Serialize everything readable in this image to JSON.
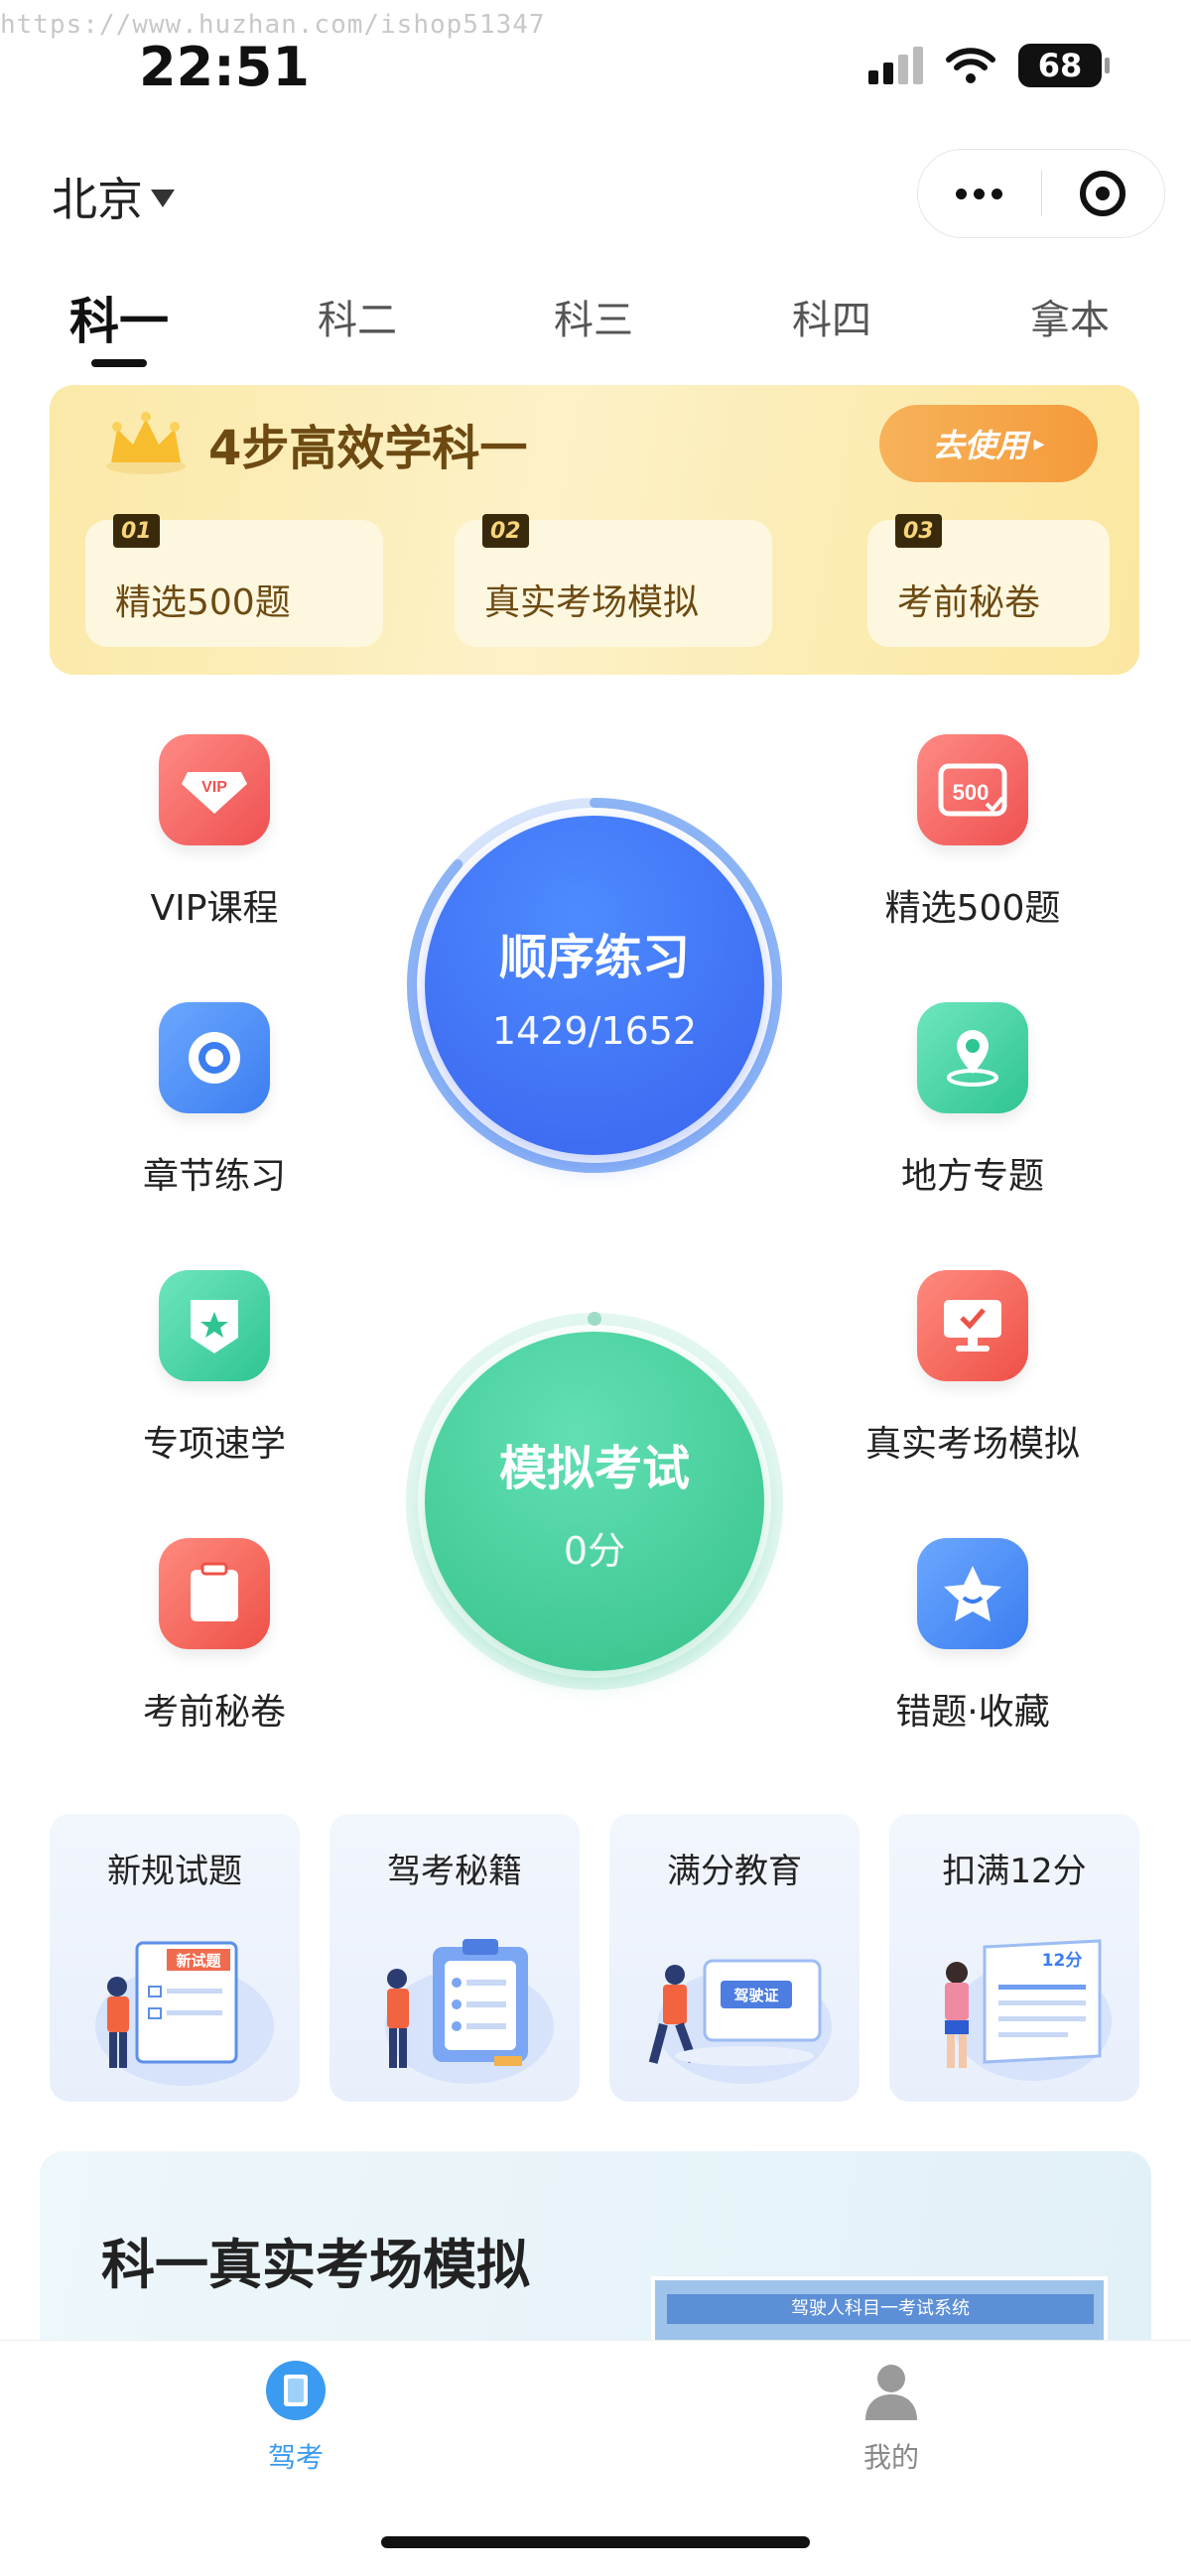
{
  "watermark": "https://www.huzhan.com/ishop51347",
  "status_bar": {
    "time": "22:51",
    "battery": "68"
  },
  "header": {
    "city": "北京"
  },
  "tabs": [
    {
      "label": "科一",
      "active": true
    },
    {
      "label": "科二",
      "active": false
    },
    {
      "label": "科三",
      "active": false
    },
    {
      "label": "科四",
      "active": false
    },
    {
      "label": "拿本",
      "active": false
    }
  ],
  "banner": {
    "title": "4步高效学科一",
    "button_label": "去使用",
    "steps": [
      {
        "num": "01",
        "label": "精选500题"
      },
      {
        "num": "02",
        "label": "真实考场模拟"
      },
      {
        "num": "03",
        "label": "考前秘卷"
      }
    ]
  },
  "features": {
    "left": [
      {
        "label": "VIP课程",
        "icon": "vip-icon",
        "color": "#f26a6a"
      },
      {
        "label": "章节练习",
        "icon": "target-icon",
        "color": "#4a8ff2"
      },
      {
        "label": "专项速学",
        "icon": "shield-star-icon",
        "color": "#3fd0a2"
      },
      {
        "label": "考前秘卷",
        "icon": "clipboard-icon",
        "color": "#f56a63"
      }
    ],
    "right": [
      {
        "label": "精选500题",
        "icon": "500-badge-icon",
        "color": "#f26a6a"
      },
      {
        "label": "地方专题",
        "icon": "location-icon",
        "color": "#3fd0a2"
      },
      {
        "label": "真实考场模拟",
        "icon": "monitor-icon",
        "color": "#f56a63"
      },
      {
        "label": "错题·收藏",
        "icon": "star-icon",
        "color": "#4a8ff2"
      }
    ]
  },
  "practice": {
    "title": "顺序练习",
    "progress": "1429/1652",
    "done": 1429,
    "total": 1652
  },
  "exam": {
    "title": "模拟考试",
    "score": "0分"
  },
  "cards": [
    {
      "title": "新规试题",
      "badge": "新试题"
    },
    {
      "title": "驾考秘籍"
    },
    {
      "title": "满分教育",
      "badge": "驾驶证"
    },
    {
      "title": "扣满12分",
      "badge": "12分"
    }
  ],
  "promo": {
    "title": "科一真实考场模拟",
    "screen_text": "驾驶人科目一考试系统"
  },
  "tabbar": [
    {
      "label": "驾考",
      "active": true,
      "icon": "book-icon"
    },
    {
      "label": "我的",
      "active": false,
      "icon": "user-icon"
    }
  ]
}
